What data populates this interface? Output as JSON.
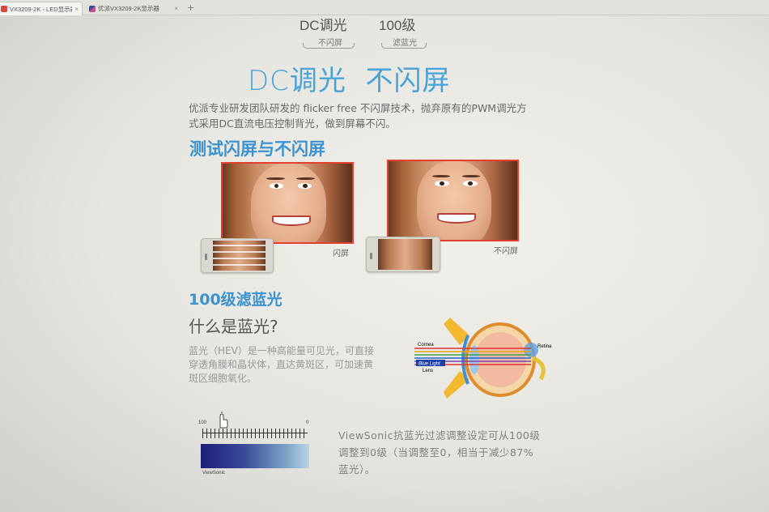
{
  "browser": {
    "tabs": [
      {
        "title": "VX3209-2K - LED显示器"
      },
      {
        "title": "优派VX3209-2K显示器"
      }
    ],
    "close_glyph": "×",
    "new_tab_glyph": "+"
  },
  "features": [
    {
      "main": "DC调光",
      "sub": "不闪屏"
    },
    {
      "main": "100级",
      "sub": "滤蓝光"
    }
  ],
  "dc_section": {
    "title": "DC调光  不闪屏",
    "paragraph_line1": "优派专业研发团队研发的 flicker free 不闪屏技术，抛弃原有的PWM调光方",
    "paragraph_line2": "式采用DC直流电压控制背光，做到屏幕不闪。"
  },
  "test_section": {
    "title": "测试闪屏与不闪屏",
    "left_caption": "闪屏",
    "right_caption": "不闪屏"
  },
  "bluelight_section": {
    "title": "100级滤蓝光",
    "question": "什么是蓝光?",
    "paragraph_line1": "蓝光（HEV）是一种高能量可见光，可直接",
    "paragraph_line2": "穿透角膜和晶状体，直达黄斑区，可加速黄",
    "paragraph_line3": "斑区细胞氧化。",
    "diagram_labels": {
      "cornea": "Cornea",
      "retina": "Retina",
      "blue_light": "Blue Light",
      "lens": "Lens"
    }
  },
  "slider": {
    "left_value": "100",
    "right_value": "0",
    "brand": "ViewSonic"
  },
  "viewsonic_text": {
    "line1": "ViewSonic抗蓝光过滤调整设定可从100级",
    "line2": "调整到0级（当调整至0，相当于减少87%",
    "line3": "蓝光）。"
  },
  "colors": {
    "accent_blue": "#3d93cf",
    "photo_border": "#e3412f",
    "slider_dark": "#1d1f78",
    "slider_light": "#b9d4e4"
  }
}
